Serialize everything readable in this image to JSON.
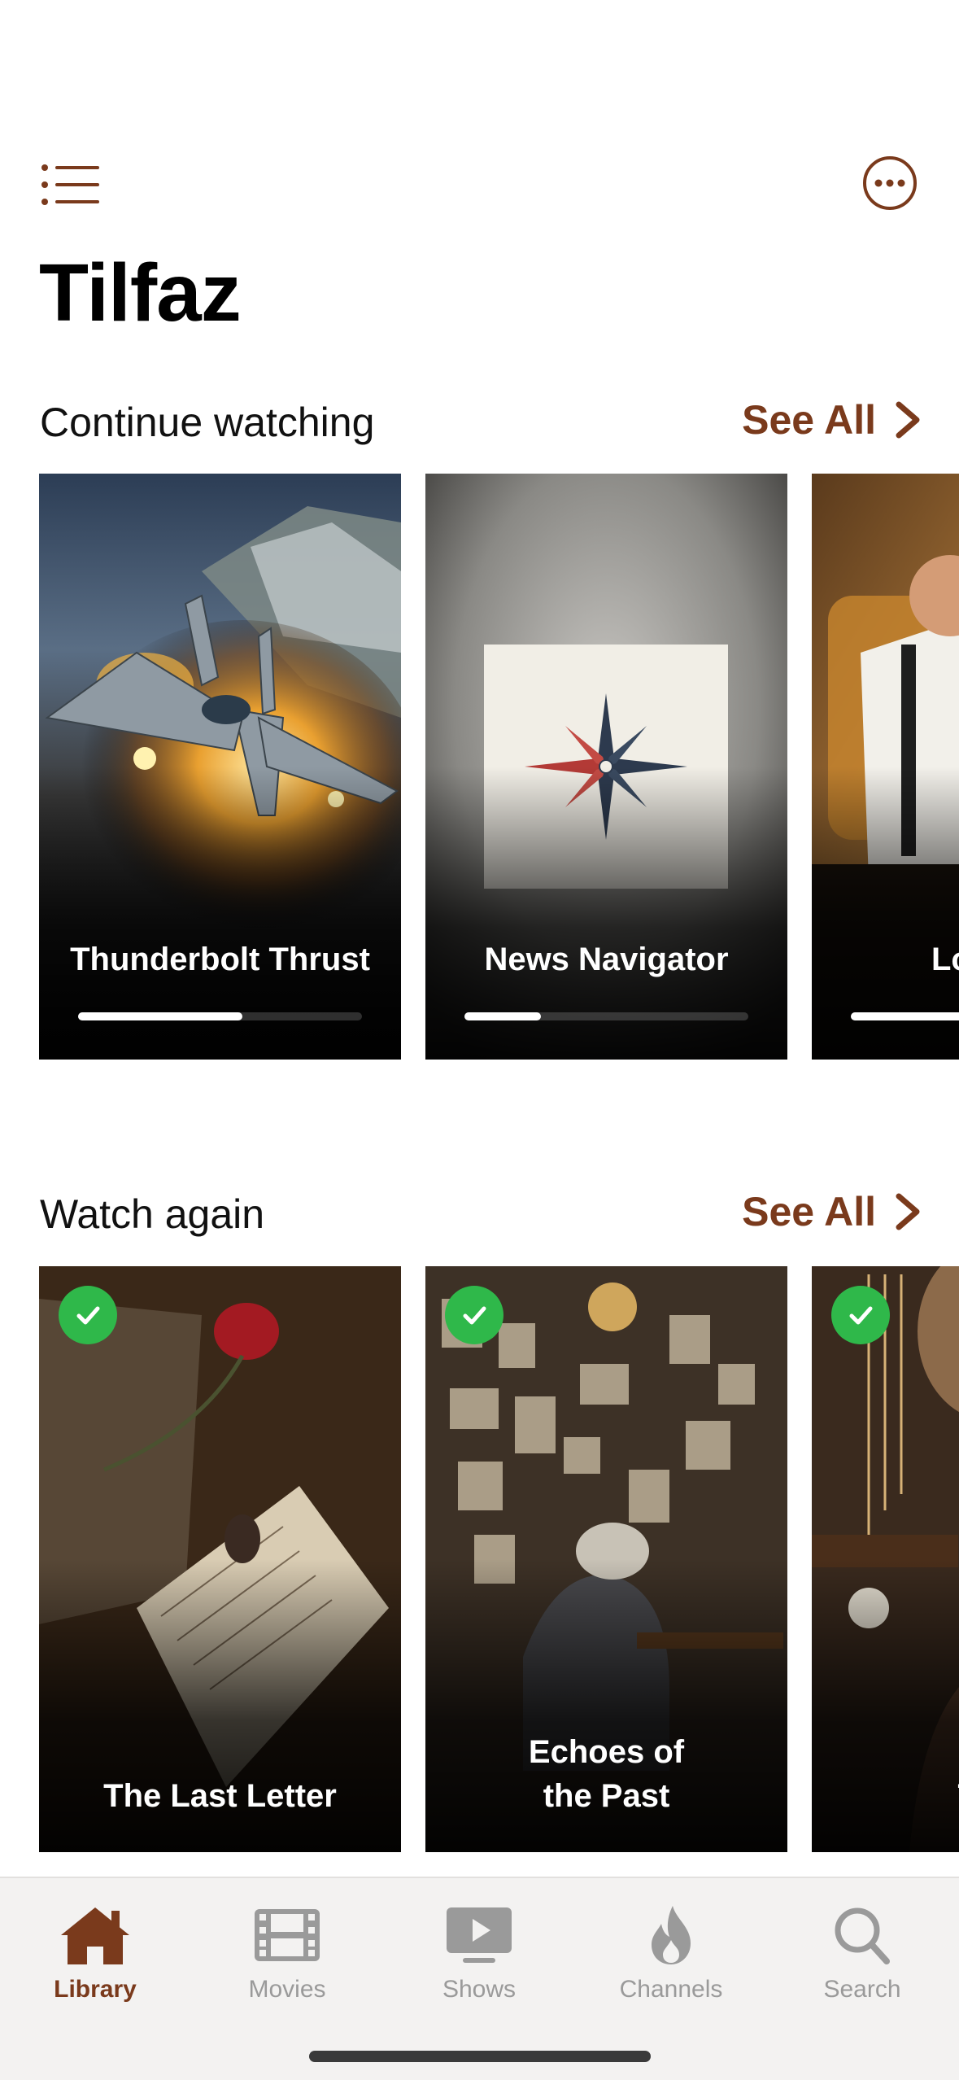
{
  "app": {
    "title": "Tilfaz"
  },
  "colors": {
    "accent": "#7a3a1c",
    "check": "#2fb84a",
    "inactive_tab": "#9a9a9a"
  },
  "toolbar": {
    "menu_icon": "list-icon",
    "more_icon": "ellipsis-circle-icon"
  },
  "continue_watching": {
    "title": "Continue watching",
    "see_all": "See All",
    "items": [
      {
        "title": "Thunderbolt Thrust",
        "progress": 0.58
      },
      {
        "title": "News Navigator",
        "progress": 0.27
      },
      {
        "title": "Lo Othe",
        "progress": 0.5
      }
    ]
  },
  "watch_again": {
    "title": "Watch again",
    "see_all": "See All",
    "items": [
      {
        "title": "The Last Letter",
        "watched": true
      },
      {
        "title": "Echoes of the Past",
        "watched": true
      },
      {
        "title": "Twili",
        "watched": true
      }
    ]
  },
  "tabs": [
    {
      "label": "Library",
      "icon": "house-icon",
      "active": true
    },
    {
      "label": "Movies",
      "icon": "film-icon",
      "active": false
    },
    {
      "label": "Shows",
      "icon": "tv-play-icon",
      "active": false
    },
    {
      "label": "Channels",
      "icon": "flame-icon",
      "active": false
    },
    {
      "label": "Search",
      "icon": "search-icon",
      "active": false
    }
  ]
}
